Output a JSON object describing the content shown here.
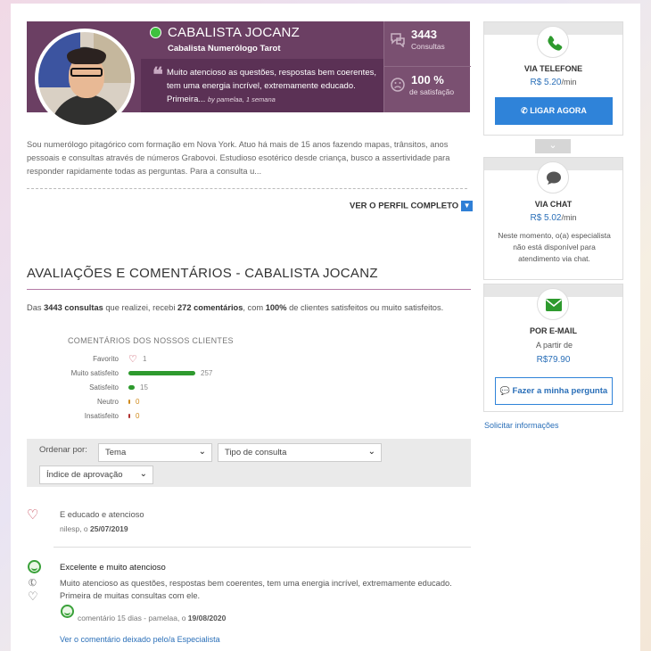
{
  "expert": {
    "name": "CABALISTA JOCANZ",
    "subtitle": "Cabalista Numerólogo Tarot",
    "status_color": "#3ec13e"
  },
  "quote": {
    "text": "Muito atencioso as questões, respostas bem coerentes, tem uma energia incrível, extremamente educado. Primeira...",
    "by": "by pamelaa, 1 semana"
  },
  "stats": {
    "consultations_value": "3443",
    "consultations_label": "Consultas",
    "satisfaction_value": "100 %",
    "satisfaction_label": "de satisfação"
  },
  "bio": "Sou numerólogo pitagórico com formação em Nova York. Atuo há mais de 15 anos fazendo mapas, trânsitos, anos pessoais e consultas através de números Grabovoi. Estudioso esotérico desde criança, busco a assertividade para responder rapidamente todas as perguntas. Para a consulta u...",
  "profile_link": "VER O PERFIL COMPLETO",
  "reviews_section": {
    "title": "AVALIAÇÕES E COMENTÁRIOS - CABALISTA JOCANZ",
    "summary_prefix": "Das ",
    "summary_count1": "3443 consultas",
    "summary_mid1": " que realizei, recebi ",
    "summary_count2": "272 comentários",
    "summary_mid2": ", com ",
    "summary_pct": "100%",
    "summary_suffix": " de clientes satisfeitos ou muito satisfeitos."
  },
  "chart_data": {
    "type": "bar",
    "title": "COMENTÁRIOS DOS NOSSOS CLIENTES",
    "categories": [
      "Favorito",
      "Muito satisfeito",
      "Satisfeito",
      "Neutro",
      "Insatisfeito"
    ],
    "values": [
      1,
      257,
      15,
      0,
      0
    ],
    "colors": [
      "#c0394b",
      "#2e9a2e",
      "#2e9a2e",
      "#d08a1c",
      "#b0302f"
    ]
  },
  "filters": {
    "label": "Ordenar por:",
    "theme": "Tema",
    "consult_type": "Tipo de consulta",
    "approval": "Índice de aprovação"
  },
  "reviews": [
    {
      "title": "E educado e atencioso",
      "author": "nilesp, o ",
      "date": "25/07/2019"
    },
    {
      "title": "Excelente e muito atencioso",
      "body": "Muito atencioso as questões, respostas bem coerentes, tem uma energia incrível, extremamente educado. Primeira de muitas consultas com ele.",
      "meta": "comentário 15 dias - pamelaa, o ",
      "date": "19/08/2020",
      "link": "Ver o comentário deixado pelo/a Especialista"
    }
  ],
  "phone_card": {
    "title": "VIA TELEFONE",
    "price": "R$ 5.20",
    "unit": "/min",
    "button": "LIGAR AGORA",
    "icon_color": "#2e9a2e"
  },
  "chat_card": {
    "title": "VIA CHAT",
    "price": "R$ 5.02",
    "unit": "/min",
    "note": "Neste momento, o(a) especialista não está disponível para atendimento via chat."
  },
  "email_card": {
    "title": "POR E-MAIL",
    "from_label": "A partir de",
    "price": "R$79.90",
    "button": "Fazer a minha pergunta",
    "icon_color": "#2e9a2e"
  },
  "solicitar": "Solicitar informações"
}
